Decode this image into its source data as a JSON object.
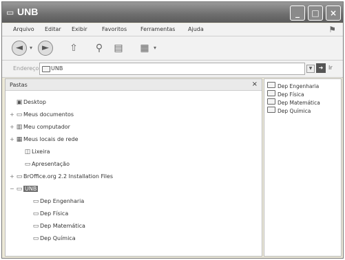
{
  "window": {
    "title": "UNB"
  },
  "menu": [
    "Arquivo",
    "Editar",
    "Exibir",
    "Favoritos",
    "Ferramentas",
    "Ajuda"
  ],
  "address": {
    "label": "Endereço",
    "value": "UNB",
    "go_label": "Ir"
  },
  "folders_pane": {
    "title": "Pastas",
    "close": "×",
    "tree": [
      {
        "label": "Desktop",
        "expander": "",
        "icon": "desktop-icon",
        "glyph": "▣"
      },
      {
        "label": "Meus documentos",
        "expander": "+",
        "icon": "folder-icon",
        "glyph": "▭"
      },
      {
        "label": "Meu computador",
        "expander": "+",
        "icon": "computer-icon",
        "glyph": "▥"
      },
      {
        "label": "Meus locais de rede",
        "expander": "+",
        "icon": "network-icon",
        "glyph": "▦"
      },
      {
        "label": "Lixeira",
        "expander": "",
        "icon": "recycle-bin-icon",
        "glyph": "◫"
      },
      {
        "label": "Apresentação",
        "expander": "",
        "icon": "folder-icon",
        "glyph": "▭"
      },
      {
        "label": "BrOffice.org 2.2 Installation Files",
        "expander": "+",
        "icon": "folder-icon",
        "glyph": "▭"
      },
      {
        "label": "UNB",
        "expander": "−",
        "icon": "folder-open-icon",
        "glyph": "▭",
        "selected": true
      },
      {
        "label": "Dep Engenharia",
        "expander": "",
        "icon": "folder-icon",
        "glyph": "▭"
      },
      {
        "label": "Dep Física",
        "expander": "",
        "icon": "folder-icon",
        "glyph": "▭"
      },
      {
        "label": "Dep Matemática",
        "expander": "",
        "icon": "folder-icon",
        "glyph": "▭"
      },
      {
        "label": "Dep Química",
        "expander": "",
        "icon": "folder-icon",
        "glyph": "▭"
      }
    ]
  },
  "files": [
    "Dep Engenharia",
    "Dep Física",
    "Dep Matemática",
    "Dep Química"
  ]
}
